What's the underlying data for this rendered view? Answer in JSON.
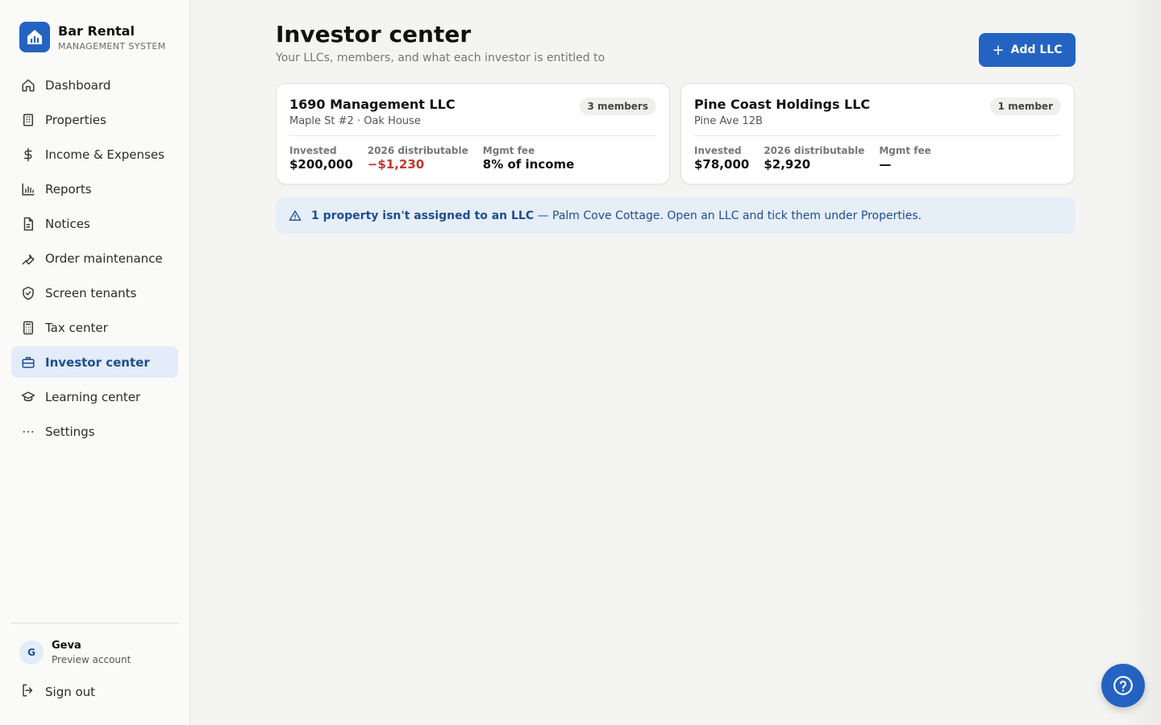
{
  "brand": {
    "name": "Bar Rental",
    "subtitle": "MANAGEMENT SYSTEM",
    "logo_icon": "house-chart-icon",
    "color": "#2463c2"
  },
  "sidebar": {
    "items": [
      {
        "label": "Dashboard",
        "icon": "home-icon",
        "active": false
      },
      {
        "label": "Properties",
        "icon": "building-icon",
        "active": false
      },
      {
        "label": "Income & Expenses",
        "icon": "dollar-icon",
        "active": false
      },
      {
        "label": "Reports",
        "icon": "bar-chart-icon",
        "active": false
      },
      {
        "label": "Notices",
        "icon": "document-icon",
        "active": false
      },
      {
        "label": "Order maintenance",
        "icon": "wrench-icon",
        "active": false
      },
      {
        "label": "Screen tenants",
        "icon": "shield-check-icon",
        "active": false
      },
      {
        "label": "Tax center",
        "icon": "calculator-icon",
        "active": false
      },
      {
        "label": "Investor center",
        "icon": "briefcase-icon",
        "active": true
      },
      {
        "label": "Learning center",
        "icon": "graduation-cap-icon",
        "active": false
      },
      {
        "label": "Settings",
        "icon": "more-dots-icon",
        "active": false
      }
    ]
  },
  "user": {
    "initial": "G",
    "name": "Geva",
    "subtitle": "Preview account"
  },
  "signout": {
    "label": "Sign out",
    "icon": "sign-out-icon"
  },
  "header": {
    "title": "Investor center",
    "subtitle": "Your LLCs, members, and what each investor is entitled to",
    "add_button": "Add LLC"
  },
  "llcs": [
    {
      "name": "1690 Management LLC",
      "properties": "Maple St #2 · Oak House",
      "members": "3 members",
      "invested_label": "Invested",
      "invested": "$200,000",
      "distributable_label": "2026 distributable",
      "distributable": "−$1,230",
      "fee_label": "Mgmt fee",
      "fee": "8% of income"
    },
    {
      "name": "Pine Coast Holdings LLC",
      "properties": "Pine Ave 12B",
      "members": "1 member",
      "invested_label": "Invested",
      "invested": "$78,000",
      "distributable_label": "2026 distributable",
      "distributable": "$2,920",
      "fee_label": "Mgmt fee",
      "fee": "—"
    }
  ],
  "banner": {
    "strong": "1 property isn't assigned to an LLC",
    "rest": " — Palm Cove Cottage. Open an LLC and tick them under Properties.",
    "icon": "warning-triangle-icon"
  },
  "help": {
    "icon": "help-circle-icon"
  },
  "colors": {
    "accent": "#2463c2",
    "active_bg": "#e3ecf8",
    "negative": "#c0392b"
  }
}
